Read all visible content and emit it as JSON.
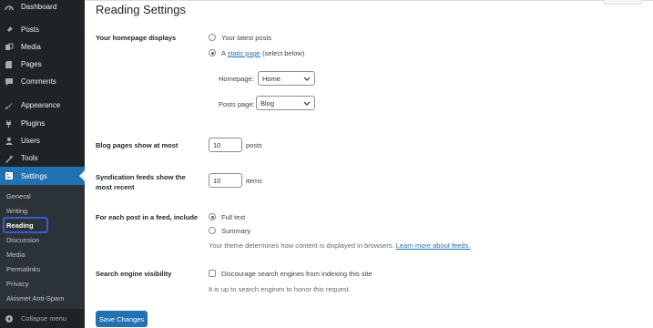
{
  "sidebar": {
    "menu": [
      {
        "label": "Dashboard",
        "icon": "dashboard-icon"
      },
      {
        "label": "Posts",
        "icon": "pushpin-icon"
      },
      {
        "label": "Media",
        "icon": "media-icon"
      },
      {
        "label": "Pages",
        "icon": "page-icon"
      },
      {
        "label": "Comments",
        "icon": "comment-icon"
      },
      {
        "label": "Appearance",
        "icon": "brush-icon"
      },
      {
        "label": "Plugins",
        "icon": "plug-icon"
      },
      {
        "label": "Users",
        "icon": "user-icon"
      },
      {
        "label": "Tools",
        "icon": "wrench-icon"
      },
      {
        "label": "Settings",
        "icon": "settings-icon"
      }
    ],
    "submenu": [
      "General",
      "Writing",
      "Reading",
      "Discussion",
      "Media",
      "Permalinks",
      "Privacy",
      "Akismet Anti-Spam"
    ],
    "collapse_label": "Collapse menu",
    "colors": {
      "bg": "#1d2327",
      "active": "#2271b1",
      "submenu_bg": "#2c3338"
    }
  },
  "page": {
    "title": "Reading Settings",
    "homepage": {
      "label": "Your homepage displays",
      "option_latest": "Your latest posts",
      "option_static_prefix": "A",
      "option_static_link": "static page",
      "option_static_suffix": "(select below)",
      "selected": "static page",
      "homepage_label": "Homepage:",
      "homepage_value": "Home",
      "posts_page_label": "Posts page:",
      "posts_page_value": "Blog"
    },
    "blog_pages": {
      "label": "Blog pages show at most",
      "value": "10",
      "unit": "posts"
    },
    "syndication": {
      "label_line1": "Syndication feeds show the",
      "label_line2": "most recent",
      "value": "10",
      "unit": "items"
    },
    "feed": {
      "label": "For each post in a feed, include",
      "option_full": "Full text",
      "option_summary": "Summary",
      "selected": "Full text",
      "note_text": "Your theme determines how content is displayed in browsers.",
      "note_link": "Learn more about feeds."
    },
    "search_engine": {
      "label": "Search engine visibility",
      "checkbox_label": "Discourage search engines from indexing this site",
      "checked": false,
      "note": "It is up to search engines to honor this request."
    },
    "save_label": "Save Changes"
  }
}
